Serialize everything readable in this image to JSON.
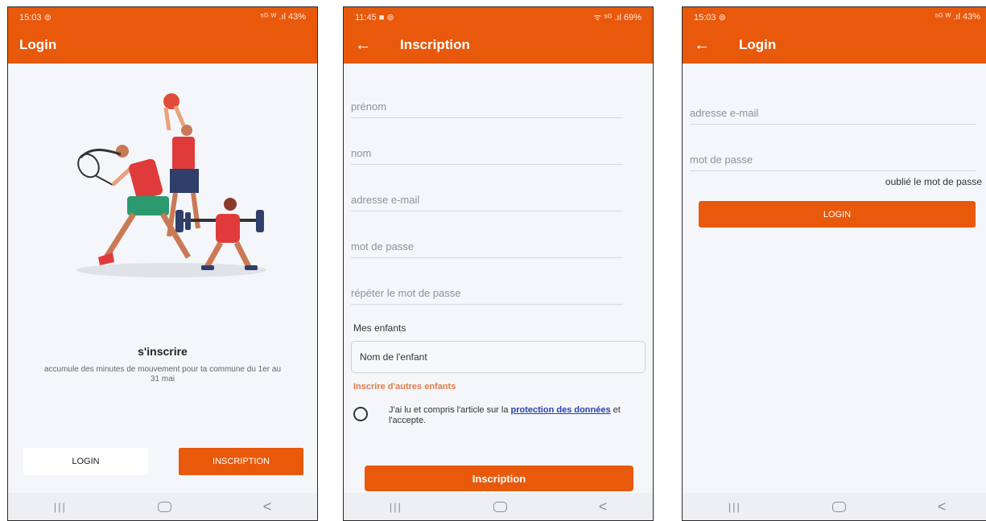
{
  "phone1": {
    "status": {
      "time": "15:03 ⊚",
      "indicators": "⁵ᴳ ᵂ .ıl 43%"
    },
    "title": "Login",
    "signup_heading": "s'inscrire",
    "signup_description": "accumule des minutes de mouvement pour ta commune du 1er au 31 mai",
    "login_button": "LOGIN",
    "signup_button": "INSCRIPTION"
  },
  "phone2": {
    "status": {
      "time": "11:45 ■ ⊚",
      "indicators": "ᯤ ⁵ᴳ .ıl 69%"
    },
    "title": "Inscription",
    "fields": {
      "first_name": "prénom",
      "last_name": "nom",
      "email": "adresse e-mail",
      "password": "mot de passe",
      "repeat_password": "répéter le mot de passe"
    },
    "children_label": "Mes enfants",
    "child_name_placeholder": "Nom de l'enfant",
    "add_children_link": "Inscrire d'autres enfants",
    "consent_prefix": "J'ai lu et compris l'article sur la ",
    "consent_link": "protection des données",
    "consent_suffix": " et l'accepte.",
    "submit_button": "Inscription"
  },
  "phone3": {
    "status": {
      "time": "15:03 ⊚",
      "indicators": "⁵ᴳ ᵂ .ıl 43%"
    },
    "title": "Login",
    "fields": {
      "email": "adresse e-mail",
      "password": "mot de passe"
    },
    "forgot_password": "oublié le mot de passe",
    "login_button": "LOGIN"
  },
  "nav": {
    "recent": "|||",
    "back": "<"
  },
  "colors": {
    "brand": "#e8590c",
    "background": "#f4f6f9",
    "link": "#2a3fb0"
  }
}
